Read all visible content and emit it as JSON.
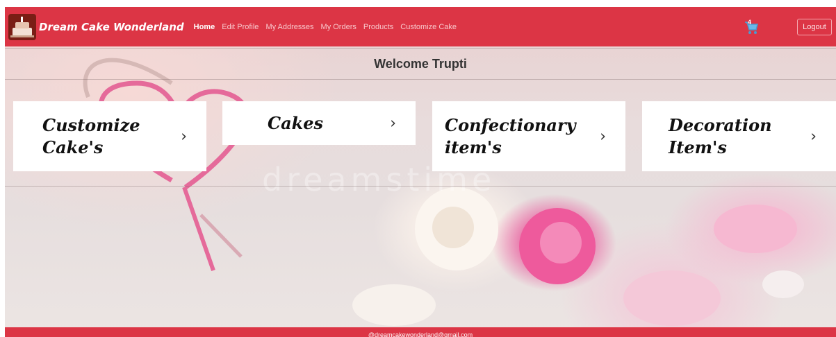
{
  "navbar": {
    "brand": "Dream Cake Wonderland",
    "links": [
      "Home",
      "Edit Profile",
      "My Addresses",
      "My Orders",
      "Products",
      "Customize Cake"
    ],
    "cart_count": "4",
    "logout": "Logout"
  },
  "welcome": "Welcome Trupti",
  "cards": [
    {
      "label": "Customize\nCake's"
    },
    {
      "label": "Cakes"
    },
    {
      "label": "Confectionary\nitem's"
    },
    {
      "label": "Decoration\nItem's"
    }
  ],
  "watermark": "dreamstime",
  "footer": "@dreamcakewonderland@gmail.com",
  "colors": {
    "navbar": "#dc3545",
    "card": "#ffffff"
  }
}
